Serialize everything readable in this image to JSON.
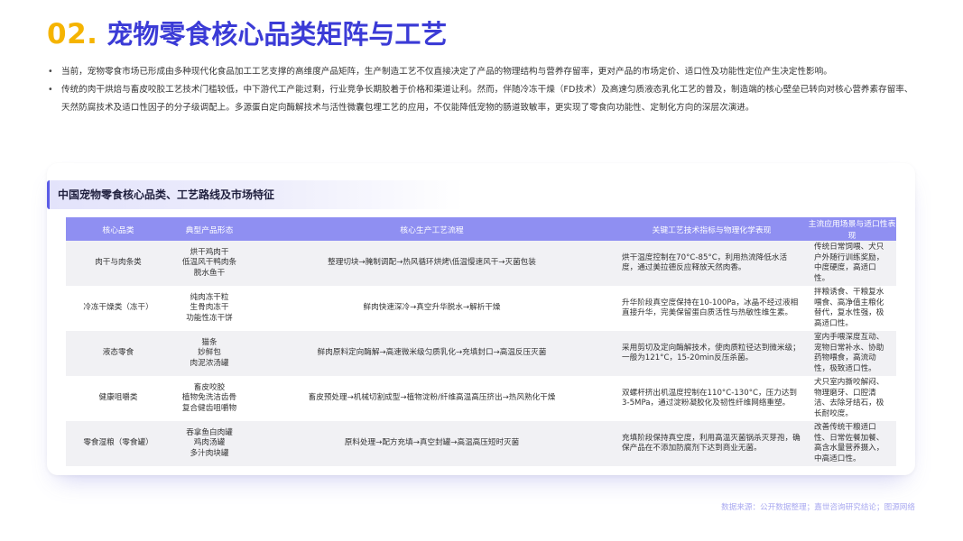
{
  "header": {
    "number": "02.",
    "title": "宠物零食核心品类矩阵与工艺"
  },
  "bullets": [
    "当前，宠物零食市场已形成由多种现代化食品加工工艺支撑的高维度产品矩阵，生产制造工艺不仅直接决定了产品的物理结构与营养存留率，更对产品的市场定价、适口性及功能性定位产生决定性影响。",
    "传统的肉干烘焙与畜皮咬胶工艺技术门槛较低，中下游代工产能过剩，行业竞争长期胶着于价格和渠道让利。然而，伴随冷冻干燥（FD技术）及高速匀质液态乳化工艺的普及，制造端的核心壁垒已转向对核心营养素存留率、天然防腐技术及适口性因子的分子级调配上。多源蛋白定向酶解技术与活性微囊包埋工艺的应用，不仅能降低宠物的肠道致敏率，更实现了零食向功能性、定制化方向的深层次演进。"
  ],
  "table": {
    "title": "中国宠物零食核心品类、工艺路线及市场特征",
    "headers": [
      "核心品类",
      "典型产品形态",
      "核心生产工艺流程",
      "关键工艺技术指标与物理化学表现",
      "主流应用场景与适口性表现"
    ],
    "rows": [
      {
        "category": "肉干与肉条类",
        "forms": [
          "烘干鸡肉干",
          "低温风干鸭肉条",
          "脱水鱼干"
        ],
        "process": "整理切块→腌制调配→热风循环烘烤\\低温慢速风干→灭菌包装",
        "tech": "烘干温度控制在70°C-85°C，利用热流降低水活度，通过美拉德反应释放天然肉香。",
        "usage": "传统日常饲喂、犬只户外随行训练奖励，中度硬度，高适口性。"
      },
      {
        "category": "冷冻干燥类（冻干）",
        "forms": [
          "纯肉冻干粒",
          "生骨肉冻干",
          "功能性冻干饼"
        ],
        "process": "鲜肉快速深冷→真空升华脱水→解析干燥",
        "tech": "升华阶段真空度保持在10-100Pa，冰晶不经过液相直接升华，完美保留蛋白质活性与热敏性维生素。",
        "usage": "拌粮诱食、干粮复水喂食、高净值主粮化替代，复水性强，极高适口性。"
      },
      {
        "category": "液态零食",
        "forms": [
          "猫条",
          "妙鲜包",
          "肉泥浓汤罐"
        ],
        "process": "鲜肉原料定向酶解→高速微米级匀质乳化→充填封口→高温反压灭菌",
        "tech": "采用剪切及定向酶解技术，使肉质粒径达到微米级；一般为121°C，15-20min反压杀菌。",
        "usage": "室内手喂深度互动、宠物日常补水、协助药物喂食，高流动性，极致适口性。"
      },
      {
        "category": "健康咀嚼类",
        "forms": [
          "畜皮咬胶",
          "植物免洗洁齿骨",
          "复合健齿咀嚼物"
        ],
        "process": "畜皮预处理→机械切割成型→植物淀粉/纤维高温高压挤出→热风熟化干燥",
        "tech": "双螺杆挤出机温度控制在110°C-130°C，压力达到3-5MPa，通过淀粉凝胶化及韧性纤维网络重塑。",
        "usage": "犬只室内撕咬解闷、物理磨牙、口腔清洁、去除牙结石，极长耐咬度。"
      },
      {
        "category": "零食湿粮（零食罐）",
        "forms": [
          "吞拿鱼白肉罐",
          "鸡肉汤罐",
          "多汁肉块罐"
        ],
        "process": "原料处理→配方充填→真空封罐→高温高压短时灭菌",
        "tech": "充填阶段保持真空度，利用高温灭菌锅杀灭芽孢，确保产品在不添加防腐剂下达到商业无菌。",
        "usage": "改善传统干粮适口性、日常佐餐加餐、高含水量营养摄入，中高适口性。"
      }
    ]
  },
  "source": "数据来源：公开数据整理；嘉世咨询研究结论；图源网络"
}
